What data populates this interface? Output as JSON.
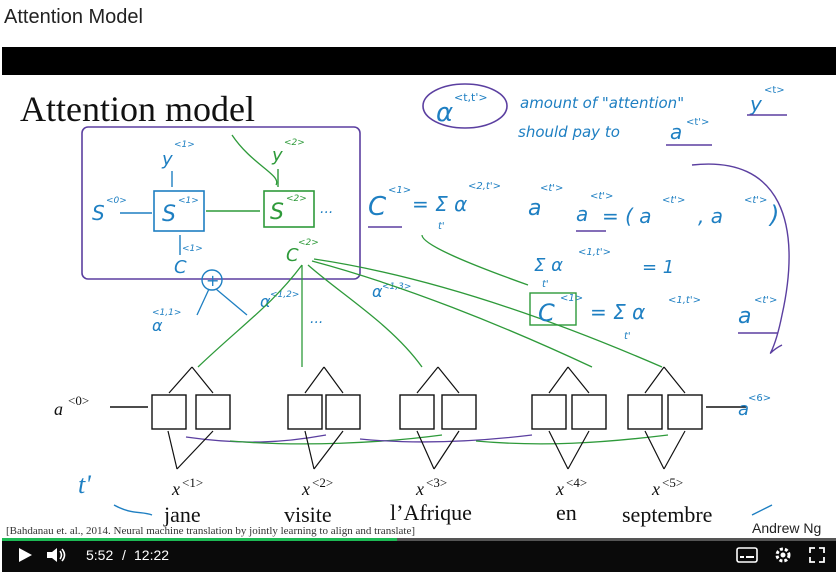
{
  "page_title": "Attention Model",
  "slide": {
    "title": "Attention model",
    "note_line1": "amount of \"attention\"",
    "note_y": "y",
    "note_y_sup": "<t>",
    "note_line2": "should pay to",
    "note_a": "a",
    "note_a_sup": "<t'>",
    "alpha_label": "α",
    "alpha_sup": "<t,t'>",
    "decoder": {
      "y1": "y",
      "y1_sup": "<1>",
      "y2": "y",
      "y2_sup": "<2>",
      "s0": "S",
      "s0_sup": "<0>",
      "s1": "S",
      "s1_sup": "<1>",
      "s2": "S",
      "s2_sup": "<2>",
      "dots": "...",
      "c": "C",
      "c_sup": "<1>",
      "c2": "C",
      "c2_sup": "<2>",
      "alpha11": "α",
      "alpha11_sup": "<1,1>",
      "alpha12": "α",
      "alpha12_sup": "<1,2>",
      "alpha13": "α",
      "alpha13_sup": "<1,3>",
      "plus": "+"
    },
    "eq1": {
      "lhs": "C",
      "lhs_sup": "<1>",
      "rhs": "= Σ α",
      "rhs_sup": "<2,t'>",
      "a": "a",
      "a_sup": "<t'>",
      "sub": "t'"
    },
    "eq2": {
      "lhs": "a",
      "lhs_sup": "<t'>",
      "rhs": "= ( a",
      "rhs_sup": "<t'>",
      "rhs2": ", a",
      "rhs2_sup": "<t'>",
      "close": ")"
    },
    "eq3": {
      "text": "Σ α",
      "sup": "<1,t'>",
      "rhs": "= 1",
      "sub": "t'"
    },
    "eq4": {
      "lhs": "C",
      "lhs_sup": "<1>",
      "rhs": "= Σ α",
      "rhs_sup": "<1,t'>",
      "a": "a",
      "a_sup": "<t'>",
      "sub": "t'"
    },
    "encoder": {
      "a0": "a",
      "a0_sup": "<0>",
      "a6": "a",
      "a6_sup": "<6>",
      "tprime": "t'",
      "inputs": [
        {
          "x": "x",
          "sup": "<1>",
          "word": "jane"
        },
        {
          "x": "x",
          "sup": "<2>",
          "word": "visite"
        },
        {
          "x": "x",
          "sup": "<3>",
          "word": "l’Afrique"
        },
        {
          "x": "x",
          "sup": "<4>",
          "word": "en"
        },
        {
          "x": "x",
          "sup": "<5>",
          "word": "septembre"
        }
      ]
    },
    "citation": "[Bahdanau et. al., 2014. Neural machine translation by jointly learning to align and translate]",
    "author": "Andrew Ng"
  },
  "player": {
    "current_time": "5:52",
    "separator": "/",
    "duration": "12:22",
    "progress_fraction": 0.474,
    "icons": [
      "play-icon",
      "volume-icon",
      "captions-icon",
      "settings-icon",
      "fullscreen-icon"
    ],
    "colors": {
      "progress": "#1db954",
      "blue_ink": "#1e7fc2",
      "green_ink": "#2e9a3a",
      "purple_ink": "#5b3fa0"
    }
  }
}
